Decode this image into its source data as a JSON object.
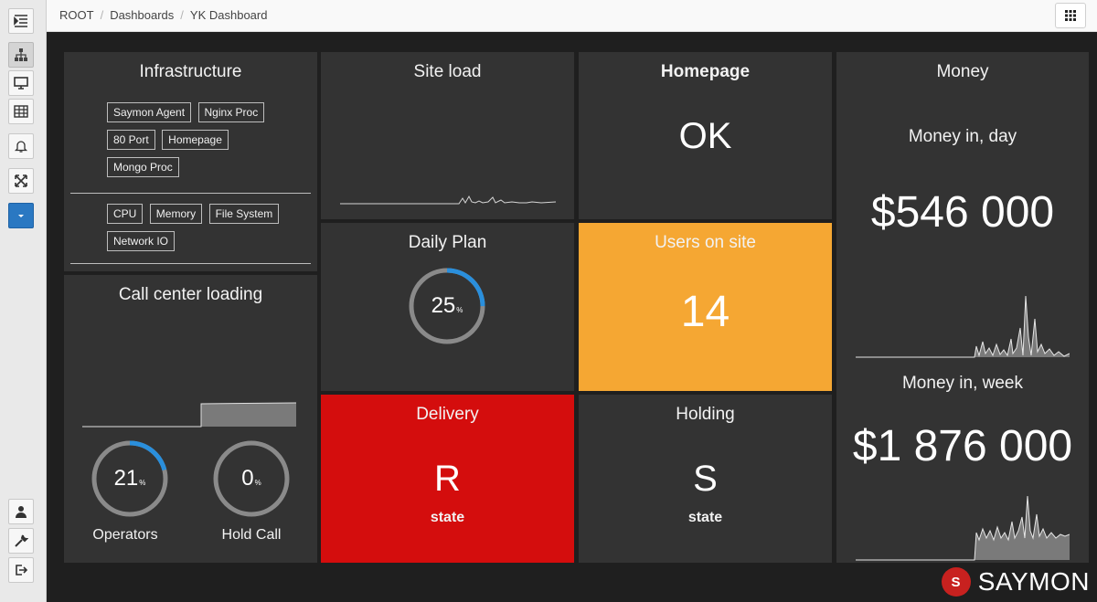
{
  "sidebar": {
    "buttons": [
      {
        "icon": "indent-icon"
      },
      {
        "icon": "sitemap-icon"
      },
      {
        "icon": "monitor-icon"
      },
      {
        "icon": "table-icon"
      },
      {
        "icon": "bell-icon"
      },
      {
        "icon": "expand-icon"
      },
      {
        "icon": "caret-down-icon"
      },
      {
        "icon": "user-icon"
      },
      {
        "icon": "wrench-icon"
      },
      {
        "icon": "logout-icon"
      }
    ]
  },
  "breadcrumb": [
    "ROOT",
    "Dashboards",
    "YK Dashboard"
  ],
  "tiles": {
    "infrastructure": {
      "title": "Infrastructure",
      "tags_top": [
        "Saymon Agent",
        "Nginx Proc",
        "80 Port",
        "Homepage",
        "Mongo Proc"
      ],
      "tags_bottom": [
        "CPU",
        "Memory",
        "File System",
        "Network IO"
      ]
    },
    "site_load": {
      "title": "Site load"
    },
    "homepage": {
      "title": "Homepage",
      "value": "OK"
    },
    "money": {
      "title": "Money",
      "day_label": "Money in, day",
      "day_value": "$546 000",
      "week_label": "Money in, week",
      "week_value": "$1 876 000"
    },
    "daily_plan": {
      "title": "Daily Plan",
      "value": "25",
      "unit": "%",
      "percent": 25
    },
    "users_on_site": {
      "title": "Users on site",
      "value": "14",
      "color": "#f5a733"
    },
    "call_center": {
      "title": "Call center loading",
      "operators": {
        "value": "21",
        "unit": "%",
        "percent": 21,
        "label": "Operators"
      },
      "hold_call": {
        "value": "0",
        "unit": "%",
        "percent": 0,
        "label": "Hold Call"
      }
    },
    "delivery": {
      "title": "Delivery",
      "value": "R",
      "sub": "state",
      "color": "#d40d0d"
    },
    "holding": {
      "title": "Holding",
      "value": "S",
      "sub": "state"
    }
  },
  "brand": {
    "name": "SAYMON",
    "mark": "S",
    "color": "#c8211f"
  },
  "colors": {
    "tile_bg": "#333333",
    "page_bg": "#1f1f1f",
    "gauge_accent": "#2a8fdc",
    "gauge_track": "#8a8a8a"
  }
}
